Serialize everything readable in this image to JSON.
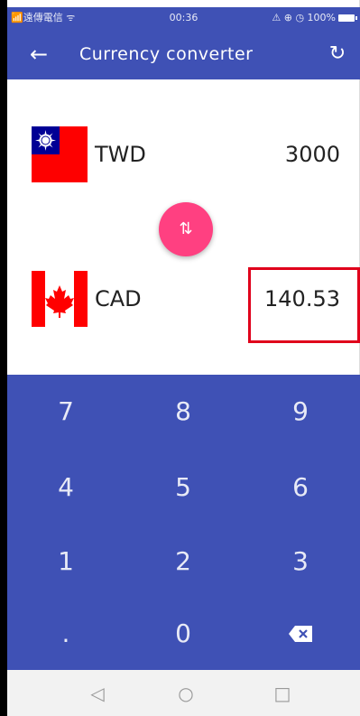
{
  "status_bar": {
    "carrier": "📶遠傳電信 ᯤ",
    "time": "00:36",
    "indicators": "⚠ ⊕ ◷ 100%"
  },
  "app_bar": {
    "back_icon": "arrow-left",
    "title": "Currency converter",
    "refresh_icon": "refresh"
  },
  "converter": {
    "from": {
      "code": "TWD",
      "amount": "3000",
      "flag": "taiwan-flag"
    },
    "to": {
      "code": "CAD",
      "amount": "140.53",
      "flag": "canada-flag"
    },
    "swap_icon": "swap-vertical"
  },
  "keypad": {
    "keys": [
      "7",
      "8",
      "9",
      "4",
      "5",
      "6",
      "1",
      "2",
      "3",
      ".",
      "0"
    ],
    "backspace_icon": "backspace"
  },
  "colors": {
    "primary": "#3f51b5",
    "accent": "#ff4081",
    "highlight": "#e0001b"
  }
}
